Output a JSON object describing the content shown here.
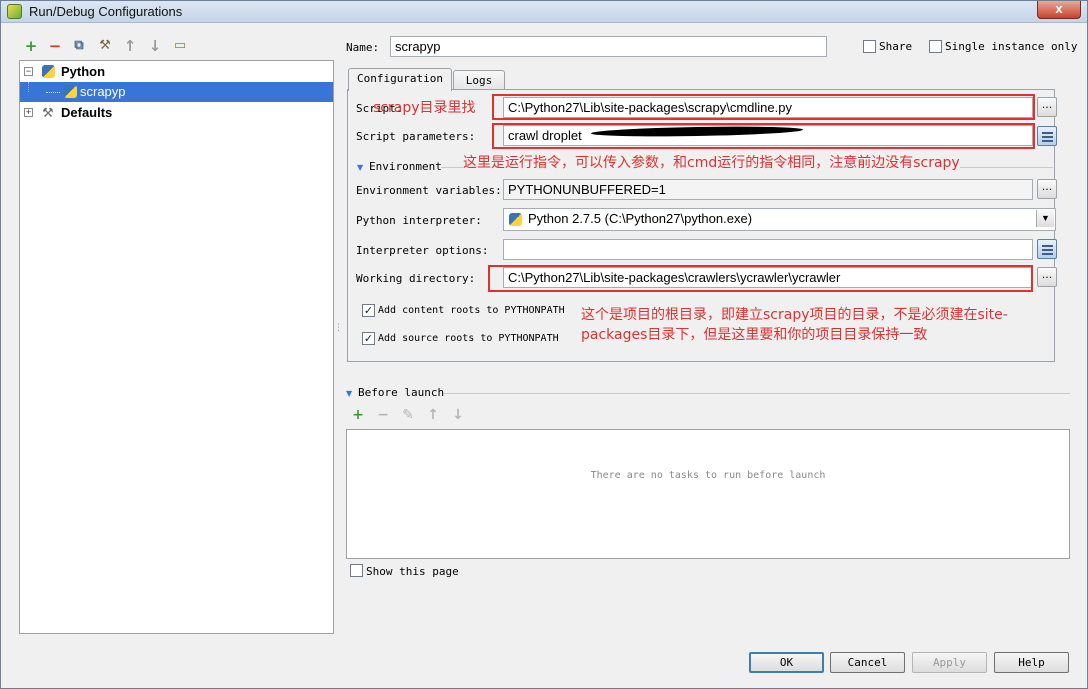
{
  "window": {
    "title": "Run/Debug Configurations",
    "close_glyph": "x"
  },
  "toolbar": {
    "icons": [
      "add-icon",
      "remove-icon",
      "copy-icon",
      "edit-defaults-icon",
      "move-up-icon",
      "move-down-icon",
      "folder-icon"
    ],
    "glyphs": {
      "add": "+",
      "remove": "−",
      "copy": "⧉",
      "wrench": "⚒",
      "up": "↑",
      "down": "↓",
      "folder": "▭"
    }
  },
  "tree": {
    "items": [
      {
        "label": "Python",
        "expander": "−"
      },
      {
        "label": "scrapyp"
      },
      {
        "label": "Defaults",
        "expander": "+"
      }
    ]
  },
  "name_field": {
    "label": "Name:",
    "value": "scrapyp"
  },
  "share": {
    "label": "Share",
    "checked": false
  },
  "single_instance": {
    "label": "Single instance only",
    "checked": false
  },
  "tabs": [
    {
      "label": "Configuration",
      "active": true
    },
    {
      "label": "Logs",
      "active": false
    }
  ],
  "config": {
    "script": {
      "label": "Script:",
      "value": "C:\\Python27\\Lib\\site-packages\\scrapy\\cmdline.py"
    },
    "script_params": {
      "label": "Script parameters:",
      "value": "crawl droplet"
    },
    "environment": {
      "label": "Environment"
    },
    "env_vars": {
      "label": "Environment variables:",
      "value": "PYTHONUNBUFFERED=1"
    },
    "interpreter": {
      "label": "Python interpreter:",
      "value": "Python 2.7.5 (C:\\Python27\\python.exe)"
    },
    "interp_options": {
      "label": "Interpreter options:",
      "value": ""
    },
    "working_dir": {
      "label": "Working directory:",
      "value": "C:\\Python27\\Lib\\site-packages\\crawlers\\ycrawler\\ycrawler"
    },
    "add_content_roots": {
      "label": "Add content roots to PYTHONPATH",
      "checked": true
    },
    "add_source_roots": {
      "label": "Add source roots to PYTHONPATH",
      "checked": true
    },
    "button_dots": "..."
  },
  "annotations": {
    "script_note": "scrapy目录里找",
    "params_note": "这里是运行指令，可以传入参数，和cmd运行的指令相同，注意前边没有scrapy",
    "workdir_note_line1": "这个是项目的根目录，即建立scrapy项目的目录，不是必须建在site-",
    "workdir_note_line2": "packages目录下，但是这里要和你的项目目录保持一致",
    "color": "#e03030"
  },
  "before_launch": {
    "label": "Before launch",
    "empty_text": "There are no tasks to run before launch",
    "toolbar_glyphs": {
      "add": "+",
      "remove": "−",
      "edit": "✎",
      "up": "↑",
      "down": "↓"
    }
  },
  "show_page": {
    "label": "Show this page",
    "checked": false
  },
  "buttons": {
    "ok": "OK",
    "cancel": "Cancel",
    "apply": "Apply",
    "help": "Help"
  },
  "colors": {
    "accent": "#3875d7",
    "annotation": "#e03030",
    "add_green": "#3a9b35",
    "remove_red": "#d9362b"
  }
}
